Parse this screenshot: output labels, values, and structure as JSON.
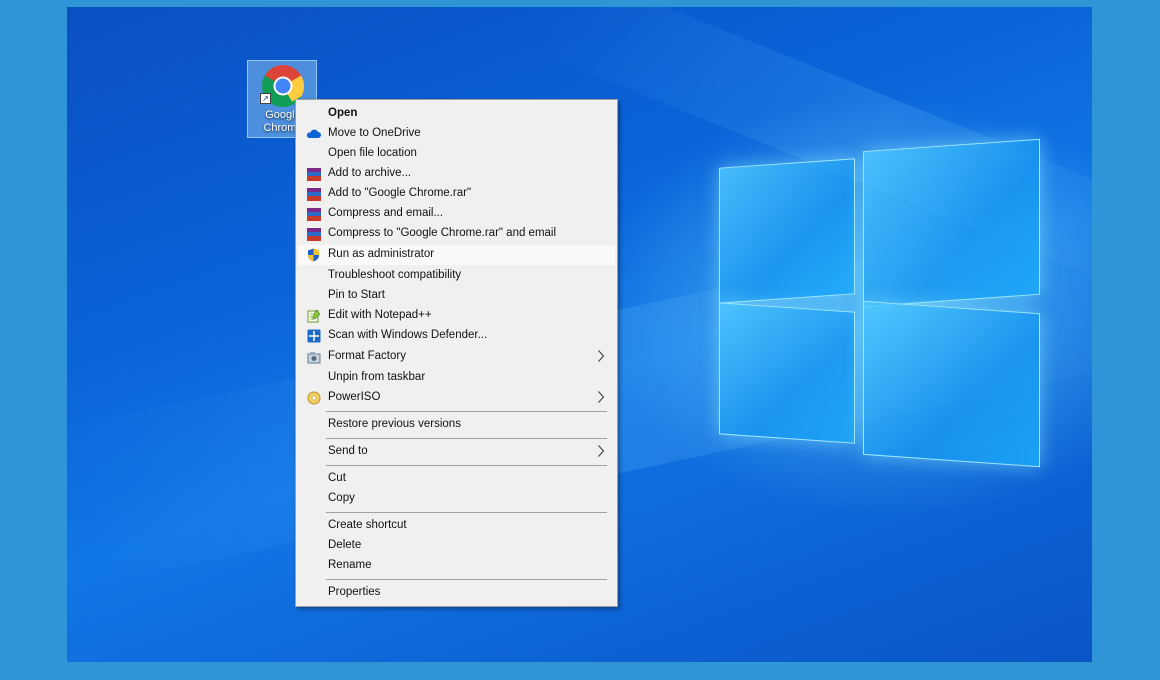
{
  "desktop": {
    "shortcut": {
      "name": "Google Chrome",
      "icon": "chrome-icon"
    }
  },
  "context_menu": {
    "items": [
      {
        "label": "Open",
        "icon": "",
        "bold": true
      },
      {
        "label": "Move to OneDrive",
        "icon": "onedrive-cloud-icon"
      },
      {
        "label": "Open file location",
        "icon": ""
      },
      {
        "label": "Add to archive...",
        "icon": "winrar-icon"
      },
      {
        "label": "Add to \"Google Chrome.rar\"",
        "icon": "winrar-icon"
      },
      {
        "label": "Compress and email...",
        "icon": "winrar-icon"
      },
      {
        "label": "Compress to \"Google Chrome.rar\" and email",
        "icon": "winrar-icon"
      },
      {
        "label": "Run as administrator",
        "icon": "uac-shield-icon",
        "highlighted": true
      },
      {
        "label": "Troubleshoot compatibility",
        "icon": ""
      },
      {
        "label": "Pin to Start",
        "icon": ""
      },
      {
        "label": "Edit with Notepad++",
        "icon": "notepadpp-icon"
      },
      {
        "label": "Scan with Windows Defender...",
        "icon": "windows-defender-icon"
      },
      {
        "label": "Format Factory",
        "icon": "format-factory-icon",
        "submenu": true
      },
      {
        "label": "Unpin from taskbar",
        "icon": ""
      },
      {
        "label": "PowerISO",
        "icon": "poweriso-icon",
        "submenu": true
      },
      {
        "label": "Restore previous versions",
        "icon": ""
      },
      {
        "label": "Send to",
        "icon": "",
        "submenu": true
      },
      {
        "label": "Cut",
        "icon": ""
      },
      {
        "label": "Copy",
        "icon": ""
      },
      {
        "label": "Create shortcut",
        "icon": ""
      },
      {
        "label": "Delete",
        "icon": ""
      },
      {
        "label": "Rename",
        "icon": ""
      },
      {
        "label": "Properties",
        "icon": ""
      }
    ]
  },
  "colors": {
    "backdrop": "#2f95d6",
    "menu_bg": "#f0f0f0",
    "menu_highlight": "#fafafa",
    "separator": "#a0a0a0"
  }
}
